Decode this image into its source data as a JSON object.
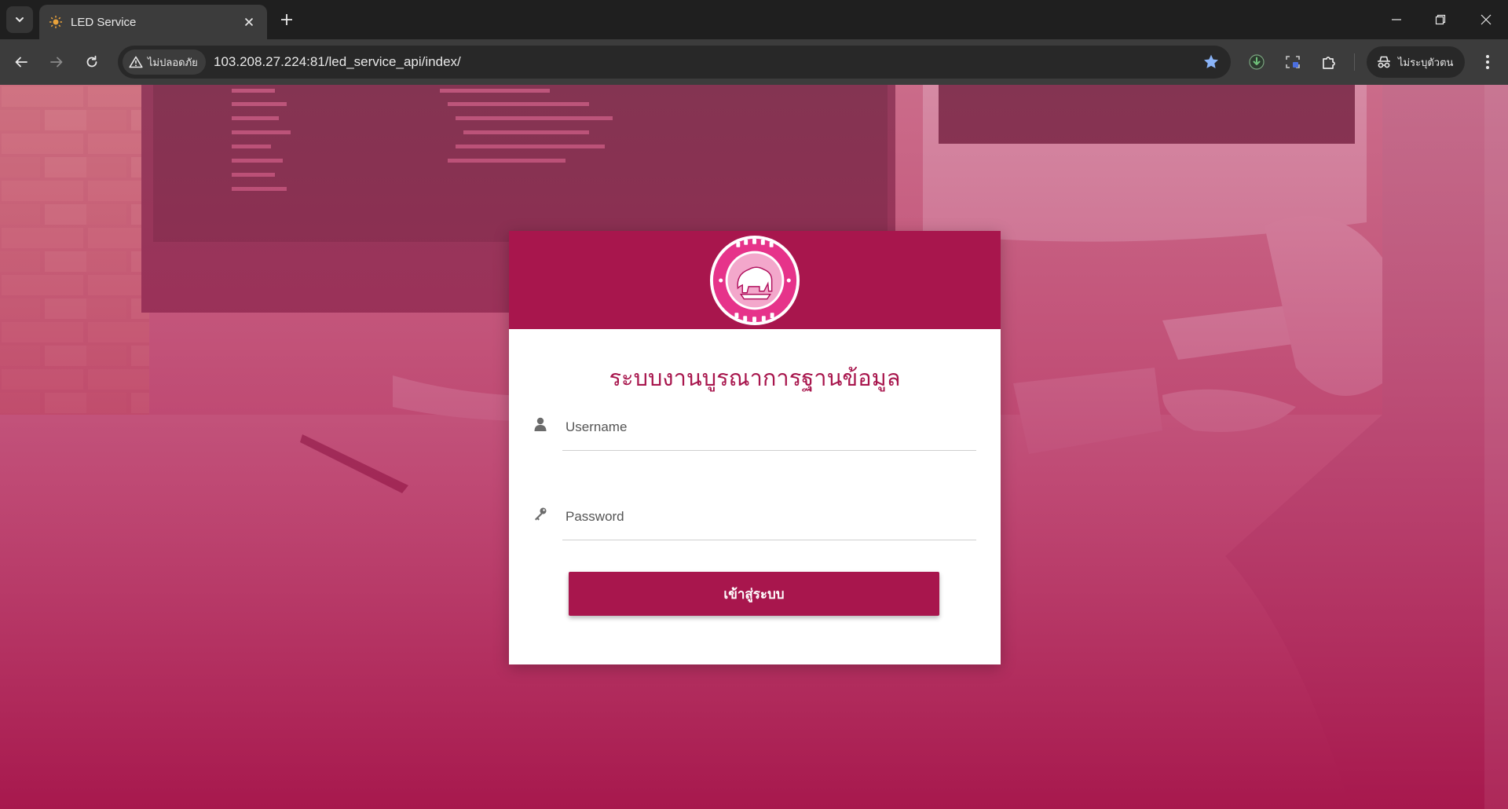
{
  "browser": {
    "tab": {
      "title": "LED Service",
      "favicon": "sun-icon"
    },
    "security_chip": {
      "icon": "warning-triangle-icon",
      "label": "ไม่ปลอดภัย"
    },
    "url": "103.208.27.224:81/led_service_api/index/",
    "profile": {
      "icon": "incognito-icon",
      "label": "ไม่ระบุตัวตน"
    }
  },
  "login": {
    "header_logo": "department-seal-logo",
    "title": "ระบบงานบูรณาการฐานข้อมูล",
    "username": {
      "placeholder": "Username",
      "icon": "user-icon",
      "value": ""
    },
    "password": {
      "placeholder": "Password",
      "icon": "key-icon",
      "value": ""
    },
    "submit_label": "เข้าสู่ระบบ"
  },
  "colors": {
    "brand": "#a8164d",
    "chrome_dark": "#1f1f1f",
    "chrome_toolbar": "#3c3c3c"
  }
}
